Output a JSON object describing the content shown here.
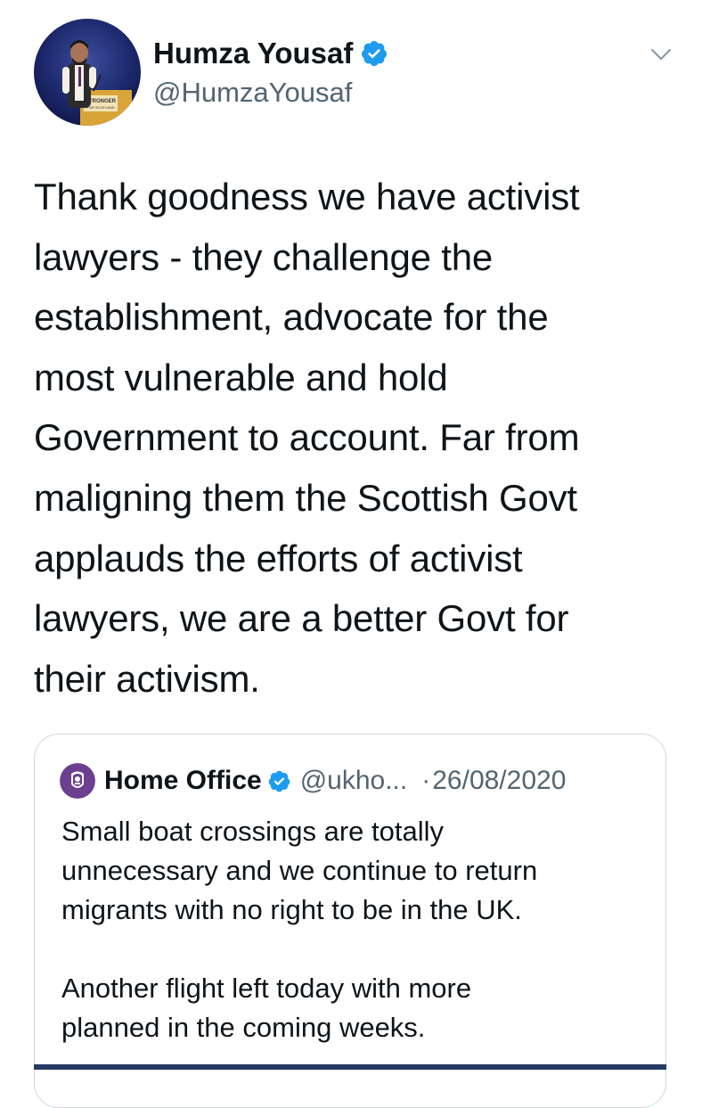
{
  "author": {
    "name": "Humza Yousaf",
    "handle": "@HumzaYousaf",
    "avatar_icon": "person-at-podium-avatar",
    "podium_sign": "STRONGER FOR SCOTLAND",
    "verified": true
  },
  "tweet": {
    "lines": [
      "Thank goodness we have activist",
      "lawyers - they challenge the",
      "establishment, advocate for the",
      "most vulnerable and hold",
      "Government to account. Far from",
      "maligning them the Scottish Govt",
      "applauds the efforts of activist",
      "lawyers, we are a better Govt for",
      "their activism."
    ]
  },
  "quoted": {
    "name": "Home Office",
    "handle": "@ukho...",
    "separator": "·",
    "date": "26/08/2020",
    "avatar_icon": "crest-avatar",
    "verified": true,
    "paragraph1": [
      "Small boat crossings are totally",
      "unnecessary and we continue to return",
      "migrants with no right to be in the UK."
    ],
    "paragraph2": [
      "Another flight left today with more",
      "planned in the coming weeks."
    ]
  },
  "colors": {
    "verified_blue": "#1d9bf0",
    "text_primary": "#0f1419",
    "text_secondary": "#536471",
    "border": "#cfd9de",
    "quote_avatar_purple": "#6c3f8f"
  },
  "icons": {
    "verified": "verified-badge-icon",
    "caret": "chevron-down-icon"
  }
}
